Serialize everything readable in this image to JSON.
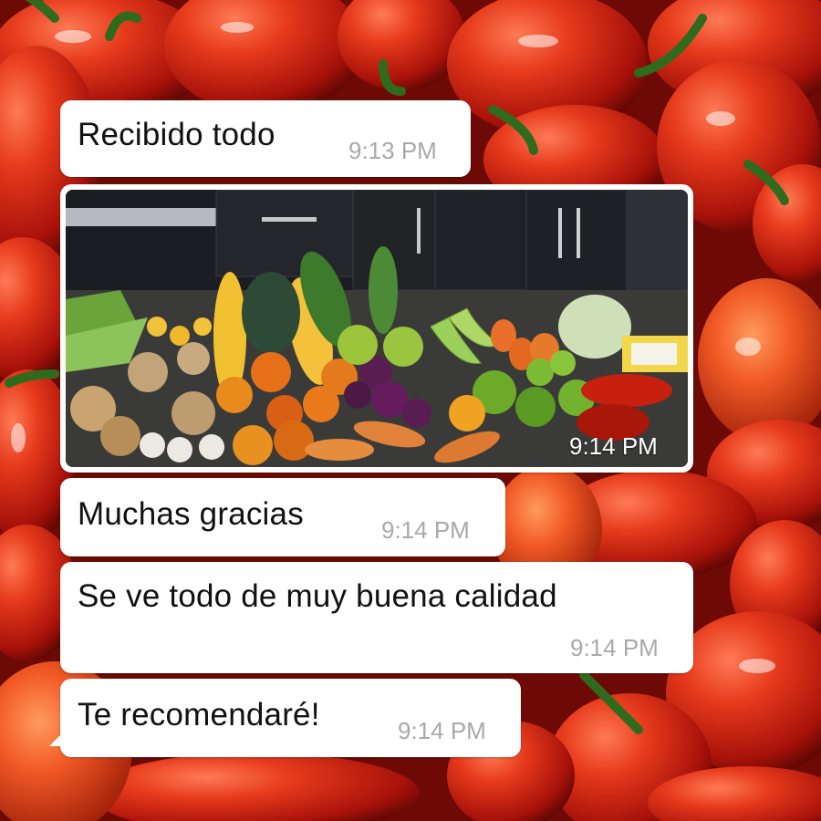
{
  "background": {
    "description_icon": "red-peppers-wallpaper",
    "base_color": "#b3160c"
  },
  "messages": [
    {
      "type": "text",
      "text": "Recibido todo",
      "time": "9:13 PM"
    },
    {
      "type": "image",
      "image_icon": "vegetables-photo",
      "time": "9:14 PM"
    },
    {
      "type": "text",
      "text": "Muchas gracias",
      "time": "9:14 PM"
    },
    {
      "type": "text",
      "text": "Se ve todo de muy buena  calidad",
      "time": "9:14 PM"
    },
    {
      "type": "text",
      "text": "Te recomendaré!",
      "time": "9:14 PM"
    }
  ],
  "colors": {
    "bubble": "#ffffff",
    "timestamp": "#a9a9a9",
    "message_text": "#111111"
  }
}
